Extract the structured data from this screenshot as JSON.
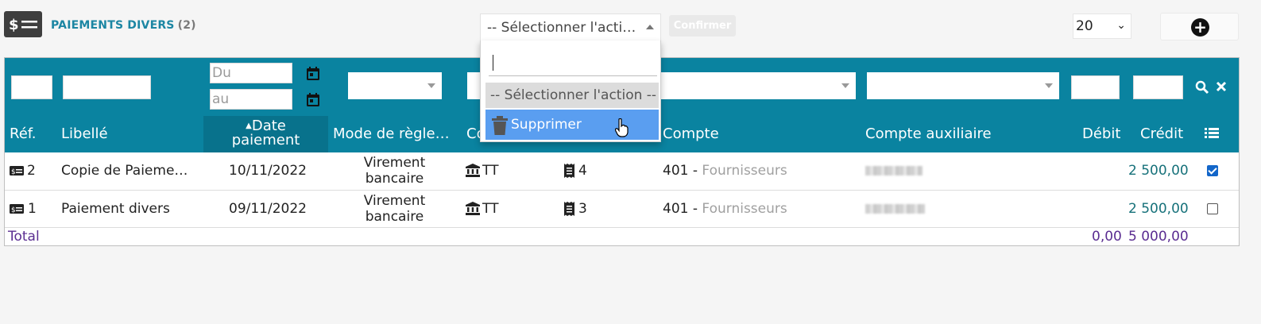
{
  "header": {
    "title": "PAIEMENTS DIVERS",
    "count": "(2)",
    "action_placeholder": "-- Sélectionner l'actio…",
    "confirm_label": "Confirmer",
    "per_page": "20"
  },
  "filters": {
    "date_from_placeholder": "Du",
    "date_to_placeholder": "au"
  },
  "columns": {
    "ref": "Réf.",
    "libelle": "Libellé",
    "date_line1": "Date",
    "date_line2": "paiement",
    "mode": "Mode de règle…",
    "co": "Co",
    "compte": "Compte",
    "compte_aux": "Compte auxiliaire",
    "debit": "Débit",
    "credit": "Crédit"
  },
  "rows": [
    {
      "ref": "2",
      "libelle": "Copie de Paieme…",
      "date": "10/11/2022",
      "mode_line1": "Virement",
      "mode_line2": "bancaire",
      "bank": "TT",
      "receipt": "4",
      "compte_num": "401",
      "compte_sep": " - ",
      "compte_name": "Fournisseurs",
      "debit": "",
      "credit": "2 500,00",
      "checked": true
    },
    {
      "ref": "1",
      "libelle": "Paiement divers",
      "date": "09/11/2022",
      "mode_line1": "Virement",
      "mode_line2": "bancaire",
      "bank": "TT",
      "receipt": "3",
      "compte_num": "401",
      "compte_sep": " - ",
      "compte_name": "Fournisseurs",
      "debit": "",
      "credit": "2 500,00",
      "checked": false
    }
  ],
  "totals": {
    "label": "Total",
    "debit": "0,00",
    "credit": "5 000,00"
  },
  "dropdown": {
    "option_placeholder": "-- Sélectionner l'action --",
    "option_delete": "Supprimer"
  },
  "colors": {
    "header_bg": "#0a83a0",
    "title": "#1c86a3",
    "highlight": "#5a9ef0"
  }
}
